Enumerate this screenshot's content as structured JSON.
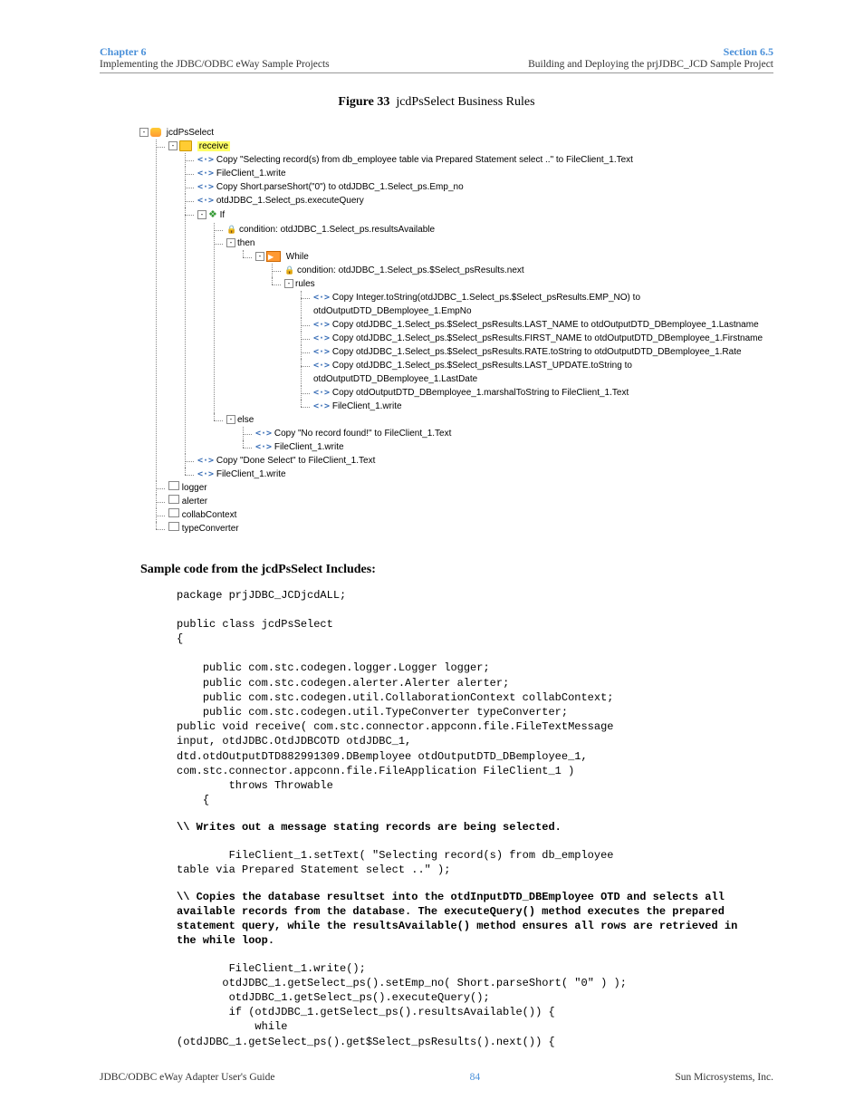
{
  "header": {
    "chapter": "Chapter 6",
    "chapterSub": "Implementing the JDBC/ODBC eWay Sample Projects",
    "section": "Section 6.5",
    "sectionSub": "Building and Deploying the prjJDBC_JCD Sample Project"
  },
  "figure": {
    "label": "Figure 33",
    "name": "jcdPsSelect Business Rules"
  },
  "tree": {
    "root": "jcdPsSelect",
    "receive": "receive",
    "r1": "Copy \"Selecting record(s) from db_employee table via Prepared Statement select ..\" to FileClient_1.Text",
    "r2": "FileClient_1.write",
    "r3": "Copy Short.parseShort(\"0\") to otdJDBC_1.Select_ps.Emp_no",
    "r4": "otdJDBC_1.Select_ps.executeQuery",
    "ifLabel": "If",
    "cond1": "condition: otdJDBC_1.Select_ps.resultsAvailable",
    "then": "then",
    "whileLabel": "While",
    "cond2": "condition: otdJDBC_1.Select_ps.$Select_psResults.next",
    "rules": "rules",
    "w1": "Copy Integer.toString(otdJDBC_1.Select_ps.$Select_psResults.EMP_NO) to otdOutputDTD_DBemployee_1.EmpNo",
    "w2": "Copy otdJDBC_1.Select_ps.$Select_psResults.LAST_NAME to otdOutputDTD_DBemployee_1.Lastname",
    "w3": "Copy otdJDBC_1.Select_ps.$Select_psResults.FIRST_NAME to otdOutputDTD_DBemployee_1.Firstname",
    "w4": "Copy otdJDBC_1.Select_ps.$Select_psResults.RATE.toString to otdOutputDTD_DBemployee_1.Rate",
    "w5": "Copy otdJDBC_1.Select_ps.$Select_psResults.LAST_UPDATE.toString to otdOutputDTD_DBemployee_1.LastDate",
    "w6": "Copy otdOutputDTD_DBemployee_1.marshalToString to FileClient_1.Text",
    "w7": "FileClient_1.write",
    "elseLabel": "else",
    "e1": "Copy \"No record found!\" to FileClient_1.Text",
    "e2": "FileClient_1.write",
    "a1": "Copy \"Done Select\" to FileClient_1.Text",
    "a2": "FileClient_1.write",
    "logger": "logger",
    "alerter": "alerter",
    "collab": "collabContext",
    "typeconv": "typeConverter"
  },
  "heading": "Sample code from the jcdPsSelect Includes:",
  "code": {
    "block1": "package prjJDBC_JCDjcdALL;\n\npublic class jcdPsSelect\n{\n\n    public com.stc.codegen.logger.Logger logger;\n    public com.stc.codegen.alerter.Alerter alerter;\n    public com.stc.codegen.util.CollaborationContext collabContext;\n    public com.stc.codegen.util.TypeConverter typeConverter;\npublic void receive( com.stc.connector.appconn.file.FileTextMessage \ninput, otdJDBC.OtdJDBCOTD otdJDBC_1, \ndtd.otdOutputDTD882991309.DBemployee otdOutputDTD_DBemployee_1, \ncom.stc.connector.appconn.file.FileApplication FileClient_1 )\n        throws Throwable\n    {",
    "comment1": "\\\\ Writes out a message stating records are being selected.",
    "block2": "        FileClient_1.setText( \"Selecting record(s) from db_employee \ntable via Prepared Statement select ..\" );",
    "comment2": "\\\\ Copies the database resultset into the otdInputDTD_DBEmployee OTD and selects all available records from the database. The executeQuery() method executes the prepared statement query, while the resultsAvailable() method ensures all rows are retrieved in the while loop.",
    "block3": "        FileClient_1.write();\n       otdJDBC_1.getSelect_ps().setEmp_no( Short.parseShort( \"0\" ) );\n        otdJDBC_1.getSelect_ps().executeQuery();\n        if (otdJDBC_1.getSelect_ps().resultsAvailable()) {\n            while \n(otdJDBC_1.getSelect_ps().get$Select_psResults().next()) {"
  },
  "footer": {
    "left": "JDBC/ODBC eWay Adapter User's Guide",
    "page": "84",
    "right": "Sun Microsystems, Inc."
  }
}
